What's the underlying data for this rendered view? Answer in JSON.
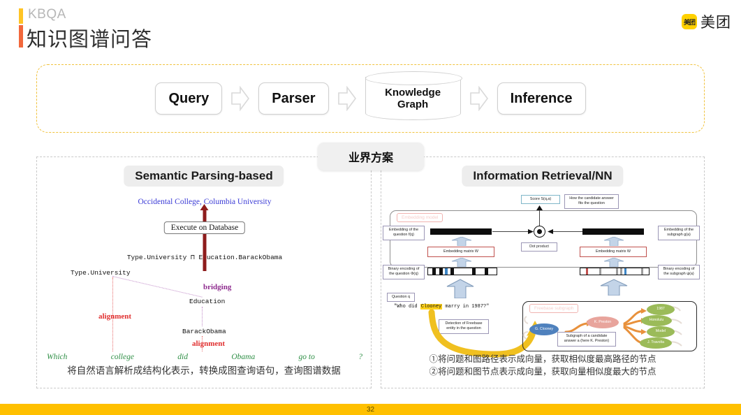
{
  "header": {
    "kicker": "KBQA",
    "title": "知识图谱问答",
    "logo_mark": "美团",
    "logo_text": "美团"
  },
  "pipeline": {
    "steps": [
      {
        "label": "Query",
        "shape": "rounded-box"
      },
      {
        "label": "Parser",
        "shape": "rounded-box"
      },
      {
        "label_line1": "Knowledge",
        "label_line2": "Graph",
        "shape": "cylinder"
      },
      {
        "label": "Inference",
        "shape": "rounded-box"
      }
    ],
    "arrow_icon": "block-arrow-right-icon"
  },
  "center_badge": {
    "label": "业界方案"
  },
  "left_panel": {
    "title": "Semantic Parsing-based",
    "answer": "Occidental College, Columbia University",
    "execute_box": "Execute on Database",
    "logical_form": "Type.University ⊓ Education.BarackObama",
    "nodes": {
      "type_university": "Type.University",
      "education": "Education",
      "barack_obama": "BarackObama"
    },
    "labels": {
      "bridging": "bridging",
      "alignment_1": "alignment",
      "alignment_2": "alignment"
    },
    "question_tokens": [
      "Which",
      "college",
      "did",
      "Obama",
      "go to",
      "?"
    ],
    "caption": "将自然语言解析成结构化表示，转换成图查询语句，查询图谱数据"
  },
  "right_panel": {
    "title": "Information Retrieval/NN",
    "caption_line1": "①将问题和图路径表示成向量，获取相似度最高路径的节点",
    "caption_line2": "②将问题和图节点表示成向量，获取向量相似度最大的节点",
    "diagram": {
      "score_box": "Score S(q,a)",
      "score_note_line1": "How the candidate answer",
      "score_note_line2": "fits the question",
      "embedding_model_ghost": "Embedding model",
      "freebase_subgraph_ghost": "Freebase subgraph",
      "embedding_question_line1": "Embedding of the",
      "embedding_question_line2": "question f(q)",
      "embedding_subgraph_line1": "Embedding of the",
      "embedding_subgraph_line2": "subgraph g(a)",
      "embedding_matrix_left": "Embedding matrix W",
      "embedding_matrix_right": "Embedding matrix W",
      "dot_product": "Dot product",
      "binary_question_line1": "Binary encoding of",
      "binary_question_line2": "the question Φ(q)",
      "binary_subgraph_line1": "Binary encoding of",
      "binary_subgraph_line2": "the subgraph ψ(a)",
      "question_label": "Question q",
      "question_prefix": "\"Who did ",
      "question_highlight": "Clooney",
      "question_suffix": " marry in 1987?\"",
      "detection_line1": "Detection of Freebase",
      "detection_line2": "entity in the question",
      "subgraph_note_line1": "Subgraph of a candidate",
      "subgraph_note_line2": "answer a (here K. Preston)",
      "graph_nodes": [
        {
          "label": "G. Clooney",
          "color": "#4f81bd"
        },
        {
          "label": "K. Preston",
          "color": "#e8a49c"
        },
        {
          "label": "1987",
          "color": "#9bbb59"
        },
        {
          "label": "Honolulu",
          "color": "#9bbb59"
        },
        {
          "label": "Model",
          "color": "#9bbb59"
        },
        {
          "label": "J. Travolta",
          "color": "#9bbb59"
        }
      ]
    }
  },
  "footer": {
    "page_number": "32"
  },
  "colors": {
    "accent_yellow": "#ffc425",
    "accent_orange": "#f2683c",
    "footer_bar": "#ffc000",
    "dashed_border": "#f0c23c",
    "answer_blue": "#3b3bd6",
    "arrow_dark_red": "#8e1c1c",
    "alignment_red": "#e03030",
    "bridging_purple": "#8e2b8e",
    "question_green": "#2f8f46"
  }
}
